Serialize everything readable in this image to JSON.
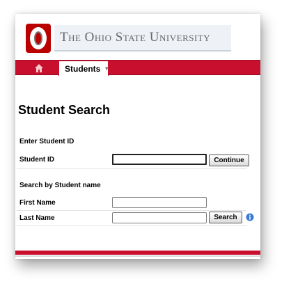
{
  "header": {
    "university_name": "The Ohio State University",
    "logo_icon": "ohio-state-o-logo"
  },
  "nav": {
    "home_icon": "home-icon",
    "tab_label": "Students",
    "tab_caret_icon": "chevron-down-icon"
  },
  "page": {
    "title": "Student Search"
  },
  "id_search": {
    "section_label": "Enter Student ID",
    "student_id_label": "Student ID",
    "student_id_value": "",
    "continue_label": "Continue"
  },
  "name_search": {
    "section_label": "Search by Student name",
    "first_name_label": "First Name",
    "first_name_value": "",
    "last_name_label": "Last Name",
    "last_name_value": "",
    "search_label": "Search",
    "info_icon": "info-icon"
  },
  "colors": {
    "brand_red": "#c8102e",
    "logo_text": "#666666"
  }
}
